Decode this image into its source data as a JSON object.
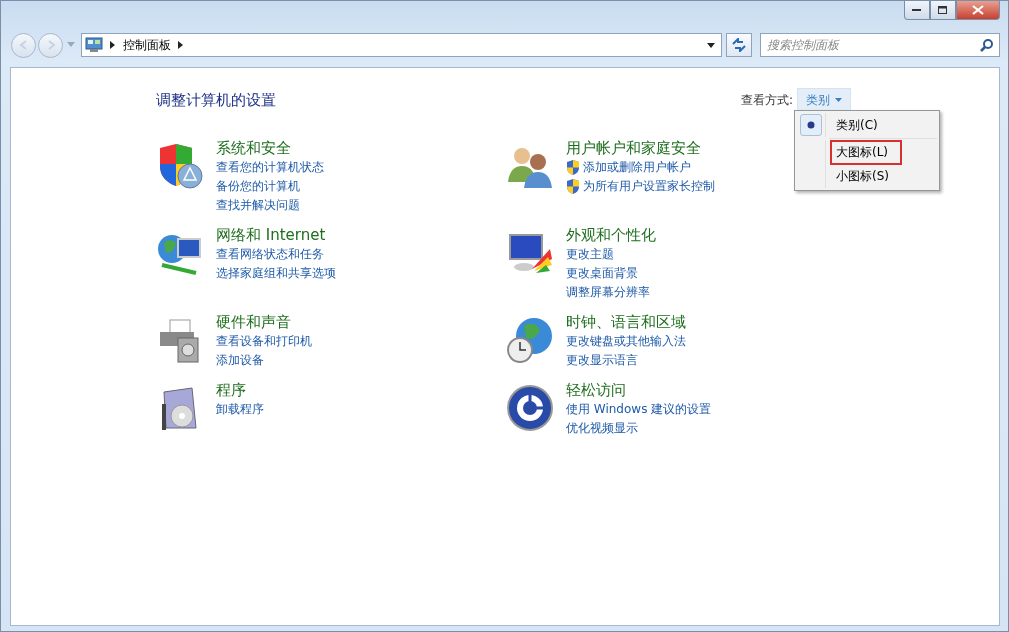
{
  "address_bar": {
    "path": [
      "控制面板"
    ]
  },
  "search": {
    "placeholder": "搜索控制面板"
  },
  "heading": "调整计算机的设置",
  "view_by": {
    "label": "查看方式:",
    "value": "类别",
    "expanded": true
  },
  "view_menu": [
    {
      "label": "类别(C)",
      "selected": true,
      "highlighted": false
    },
    {
      "label": "大图标(L)",
      "selected": false,
      "highlighted": true
    },
    {
      "label": "小图标(S)",
      "selected": false,
      "highlighted": false
    }
  ],
  "categories": [
    {
      "title": "系统和安全",
      "links": [
        {
          "label": "查看您的计算机状态",
          "kind": "plain"
        },
        {
          "label": "备份您的计算机",
          "kind": "plain"
        },
        {
          "label": "查找并解决问题",
          "kind": "plain"
        }
      ]
    },
    {
      "title": "用户帐户和家庭安全",
      "links": [
        {
          "label": "添加或删除用户帐户",
          "kind": "shield"
        },
        {
          "label": "为所有用户设置家长控制",
          "kind": "shield"
        }
      ]
    },
    {
      "title": "网络和 Internet",
      "links": [
        {
          "label": "查看网络状态和任务",
          "kind": "plain"
        },
        {
          "label": "选择家庭组和共享选项",
          "kind": "plain"
        }
      ]
    },
    {
      "title": "外观和个性化",
      "links": [
        {
          "label": "更改主题",
          "kind": "plain"
        },
        {
          "label": "更改桌面背景",
          "kind": "plain"
        },
        {
          "label": "调整屏幕分辨率",
          "kind": "plain"
        }
      ]
    },
    {
      "title": "硬件和声音",
      "links": [
        {
          "label": "查看设备和打印机",
          "kind": "plain"
        },
        {
          "label": "添加设备",
          "kind": "plain"
        }
      ]
    },
    {
      "title": "时钟、语言和区域",
      "links": [
        {
          "label": "更改键盘或其他输入法",
          "kind": "plain"
        },
        {
          "label": "更改显示语言",
          "kind": "plain"
        }
      ]
    },
    {
      "title": "程序",
      "links": [
        {
          "label": "卸载程序",
          "kind": "plain"
        }
      ]
    },
    {
      "title": "轻松访问",
      "links": [
        {
          "label": "使用 Windows 建议的设置",
          "kind": "plain"
        },
        {
          "label": "优化视频显示",
          "kind": "plain"
        }
      ]
    }
  ]
}
